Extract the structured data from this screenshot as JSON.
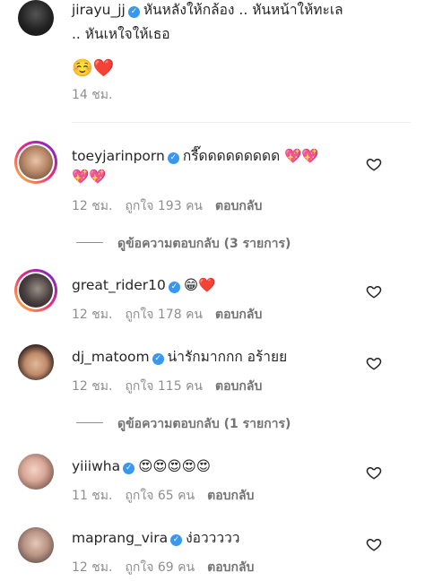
{
  "post": {
    "username": "jirayu_jj",
    "caption_line1": "หันหลังให้กล้อง .. หันหน้าให้ทะเล",
    "caption_line2": ".. หันเหใจให้เธอ",
    "emojis": "☺️❤️",
    "time": "14 ชม."
  },
  "comments": [
    {
      "username": "toeyjarinporn",
      "text": "กรี๊ดดดดดดดดด 💖💖",
      "text2": "💖💖",
      "time": "12 ชม.",
      "likes": "ถูกใจ 193 คน",
      "reply": "ตอบกลับ",
      "view_replies": "ดูข้อความตอบกลับ (3 รายการ)"
    },
    {
      "username": "great_rider10",
      "text": "😁❤️",
      "time": "12 ชม.",
      "likes": "ถูกใจ 178 คน",
      "reply": "ตอบกลับ"
    },
    {
      "username": "dj_matoom",
      "text": "น่ารักมากกก อร้ายย",
      "time": "12 ชม.",
      "likes": "ถูกใจ 115 คน",
      "reply": "ตอบกลับ",
      "view_replies": "ดูข้อความตอบกลับ (1 รายการ)"
    },
    {
      "username": "yiiiwha",
      "text": "😍😍😍😍😍",
      "time": "11 ชม.",
      "likes": "ถูกใจ 65 คน",
      "reply": "ตอบกลับ"
    },
    {
      "username": "maprang_vira",
      "text": "ง่อววววว",
      "time": "12 ชม.",
      "likes": "ถูกใจ 69 คน",
      "reply": "ตอบกลับ"
    }
  ],
  "colors": {
    "verified": "#3897f0",
    "muted": "#8e8e8e"
  },
  "icons": {
    "like": "heart-outline-icon",
    "verified": "verified-badge-icon"
  }
}
